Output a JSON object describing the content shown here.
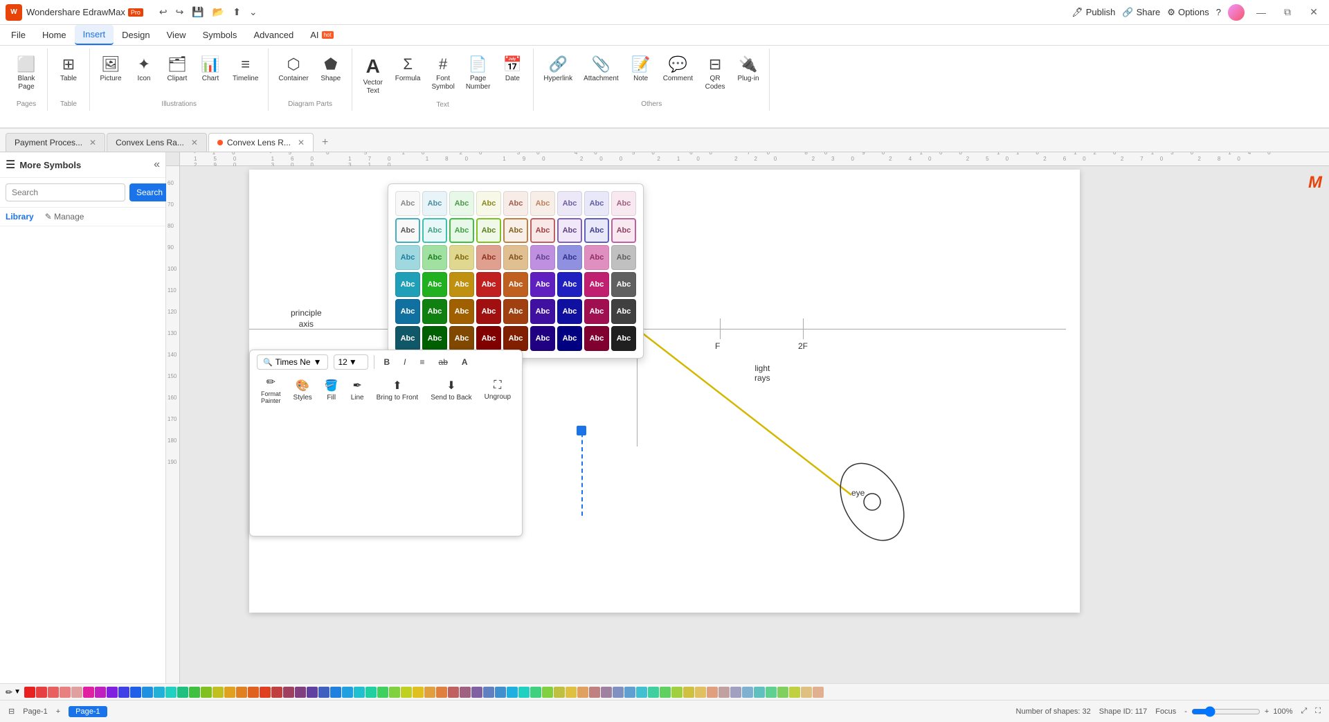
{
  "app": {
    "name": "Wondershare EdrawMax",
    "badge": "Pro",
    "title": "Wondershare EdrawMax"
  },
  "titlebar": {
    "undo_label": "↩",
    "redo_label": "↪",
    "save_label": "💾",
    "open_label": "📂",
    "export_label": "⬆",
    "more_label": "⌄",
    "publish_label": "Publish",
    "share_label": "Share",
    "options_label": "Options",
    "help_label": "?",
    "minimize_label": "—",
    "restore_label": "⧉",
    "close_label": "✕"
  },
  "menubar": {
    "items": [
      {
        "label": "File",
        "active": false
      },
      {
        "label": "Home",
        "active": false
      },
      {
        "label": "Insert",
        "active": true
      },
      {
        "label": "Design",
        "active": false
      },
      {
        "label": "View",
        "active": false
      },
      {
        "label": "Symbols",
        "active": false
      },
      {
        "label": "Advanced",
        "active": false
      },
      {
        "label": "AI",
        "active": false,
        "badge": "hot"
      }
    ]
  },
  "ribbon": {
    "groups": [
      {
        "label": "Pages",
        "items": [
          {
            "icon": "⬜",
            "label": "Blank\nPage"
          }
        ]
      },
      {
        "label": "Table",
        "items": [
          {
            "icon": "⊞",
            "label": "Table"
          }
        ]
      },
      {
        "label": "Illustrations",
        "items": [
          {
            "icon": "🖼",
            "label": "Picture"
          },
          {
            "icon": "✦",
            "label": "Icon"
          },
          {
            "icon": "📎",
            "label": "Clipart"
          },
          {
            "icon": "📊",
            "label": "Chart"
          },
          {
            "icon": "≡",
            "label": "Timeline"
          }
        ]
      },
      {
        "label": "Diagram Parts",
        "items": [
          {
            "icon": "⬡",
            "label": "Container"
          },
          {
            "icon": "⬟",
            "label": "Shape"
          }
        ]
      },
      {
        "label": "Text",
        "items": [
          {
            "icon": "A",
            "label": "Vector\nText"
          },
          {
            "icon": "Σ",
            "label": "Formula"
          },
          {
            "icon": "#",
            "label": "Font\nSymbol"
          },
          {
            "icon": "📄",
            "label": "Page\nNumber"
          },
          {
            "icon": "📅",
            "label": "Date"
          }
        ]
      },
      {
        "label": "Others",
        "items": [
          {
            "icon": "🔗",
            "label": "Hyperlink"
          },
          {
            "icon": "📎",
            "label": "Attachment"
          },
          {
            "icon": "📝",
            "label": "Note"
          },
          {
            "icon": "💬",
            "label": "Comment"
          },
          {
            "icon": "⊟",
            "label": "QR\nCodes"
          },
          {
            "icon": "🔌",
            "label": "Plug-in"
          }
        ]
      }
    ]
  },
  "tabs": [
    {
      "label": "Payment Proces...",
      "active": false,
      "closeable": true,
      "dot": false
    },
    {
      "label": "Convex Lens Ra...",
      "active": false,
      "closeable": true,
      "dot": false
    },
    {
      "label": "Convex Lens R...",
      "active": true,
      "closeable": true,
      "dot": true
    }
  ],
  "sidebar": {
    "title": "More Symbols",
    "search_placeholder": "Search",
    "search_btn": "Search",
    "nav_items": [
      {
        "label": "Library",
        "active": true
      },
      {
        "label": "Manage",
        "active": false
      }
    ]
  },
  "style_popup": {
    "rows": [
      [
        "#f8f8f8",
        "#e8f4f8",
        "#e8f8e8",
        "#f8f4e8",
        "#f8e8e8",
        "#f8f0e8",
        "#f0e8f8",
        "#e8e8f8",
        "#f8e8f0"
      ],
      [
        "#d0eef8",
        "#d0f0d0",
        "#f8f0d0",
        "#f0d0d0",
        "#f8e0d0",
        "#e8d0f8",
        "#d0d0f8",
        "#f8d0e8",
        "#e0e0e0"
      ],
      [
        "#40b8d0",
        "#40c040",
        "#e0a020",
        "#e04040",
        "#e08040",
        "#8040e0",
        "#4040e0",
        "#e04090",
        "#a0a0a0"
      ],
      [
        "#2090b8",
        "#20a020",
        "#c08010",
        "#c02020",
        "#c06020",
        "#6020c0",
        "#2020c0",
        "#c02070",
        "#606060"
      ],
      [
        "#1070a0",
        "#108010",
        "#a06000",
        "#a01010",
        "#a04010",
        "#4010a0",
        "#1010a0",
        "#a01050",
        "#404040"
      ],
      [
        "#0050808",
        "#006000",
        "#804800",
        "#800000",
        "#802000",
        "#200080",
        "#000080",
        "#800030",
        "#202020"
      ]
    ],
    "labels": [
      "Abc",
      "Abc",
      "Abc",
      "Abc",
      "Abc",
      "Abc",
      "Abc",
      "Abc"
    ]
  },
  "float_toolbar": {
    "font_name": "Times Ne",
    "font_size": "12",
    "bold_label": "B",
    "italic_label": "I",
    "align_label": "≡",
    "strikethrough_label": "ab",
    "font_case_label": "A",
    "format_painter_label": "Format\nPainter",
    "styles_label": "Styles",
    "fill_label": "Fill",
    "line_label": "Line",
    "bring_front_label": "Bring to Front",
    "send_back_label": "Send to Back",
    "ungroup_label": "Ungroup"
  },
  "diagram": {
    "principle_axis_label": "principle\naxis",
    "f_label": "F",
    "f2_label": "2F",
    "light_rays_label": "light\nrays",
    "eye_label": "eye"
  },
  "statusbar": {
    "page_label": "Page-1",
    "page_tab": "Page-1",
    "shapes_count": "Number of shapes: 32",
    "shape_id": "Shape ID: 117",
    "focus_label": "Focus",
    "zoom_level": "100%",
    "layout_icon": "⊟",
    "add_page": "+"
  },
  "colors": {
    "accent": "#1a73e8",
    "brand": "#e8440a"
  },
  "palette": [
    "#e82020",
    "#e84040",
    "#e86060",
    "#e88080",
    "#e0a0a0",
    "#e020a0",
    "#c020c0",
    "#8020e0",
    "#4040e8",
    "#2060e8",
    "#2090e0",
    "#20b0d8",
    "#20d0c0",
    "#20c080",
    "#40c040",
    "#80c020",
    "#c0c020",
    "#e0a020",
    "#e08020",
    "#e06020",
    "#e04020",
    "#c04040",
    "#a04060",
    "#804080",
    "#6040a0",
    "#4060c0",
    "#2080e0",
    "#20a0e0",
    "#20c0d0",
    "#20d0a0",
    "#40d060",
    "#80d040",
    "#c0d020",
    "#e0c020",
    "#e0a040",
    "#e08040",
    "#c06060",
    "#a06080",
    "#8060a0",
    "#6080c0",
    "#4090d0",
    "#20b0e0",
    "#20d0c0",
    "#40d080",
    "#80d040",
    "#c0c040",
    "#e0c040",
    "#e0a060",
    "#c08080",
    "#a080a0",
    "#8090c0",
    "#60a0d0",
    "#40c0d0",
    "#40d0a0",
    "#60d060",
    "#a0d040",
    "#d0c040",
    "#e0c060",
    "#e0a080",
    "#c0a0a0",
    "#a0a0c0",
    "#80b0d0",
    "#60c0c0",
    "#60d090",
    "#80d060",
    "#c0d040",
    "#e0c080",
    "#e0b090"
  ]
}
